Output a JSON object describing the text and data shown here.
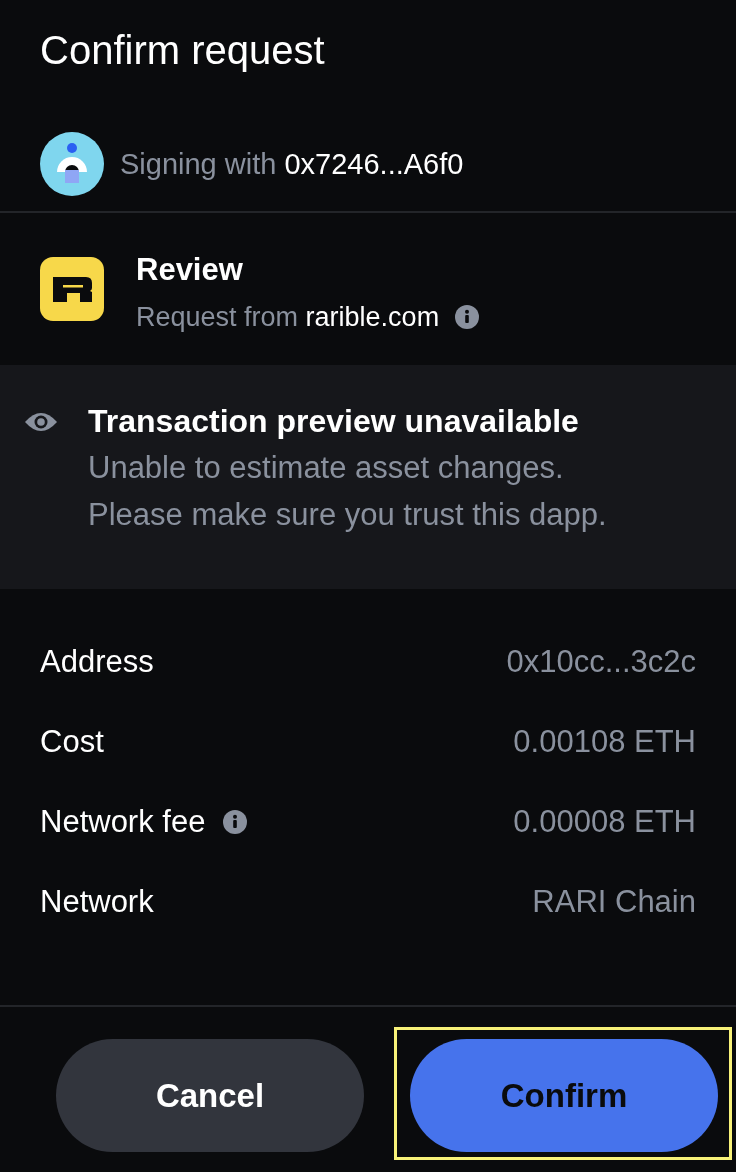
{
  "header": {
    "title": "Confirm request"
  },
  "signer": {
    "label": "Signing with",
    "address": "0x7246...A6f0"
  },
  "request": {
    "title": "Review",
    "label": "Request from",
    "origin": "rarible.com"
  },
  "preview": {
    "title": "Transaction preview unavailable",
    "message": "Unable to estimate asset changes.\nPlease make sure you trust this dapp."
  },
  "details": [
    {
      "label": "Address",
      "value": "0x10cc...3c2c",
      "info": false
    },
    {
      "label": "Cost",
      "value": "0.00108 ETH",
      "info": false
    },
    {
      "label": "Network fee",
      "value": "0.00008 ETH",
      "info": true
    },
    {
      "label": "Network",
      "value": "RARI Chain",
      "info": false
    }
  ],
  "actions": [
    {
      "label": "Cancel",
      "kind": "secondary",
      "highlighted": false
    },
    {
      "label": "Confirm",
      "kind": "primary",
      "highlighted": true
    }
  ]
}
